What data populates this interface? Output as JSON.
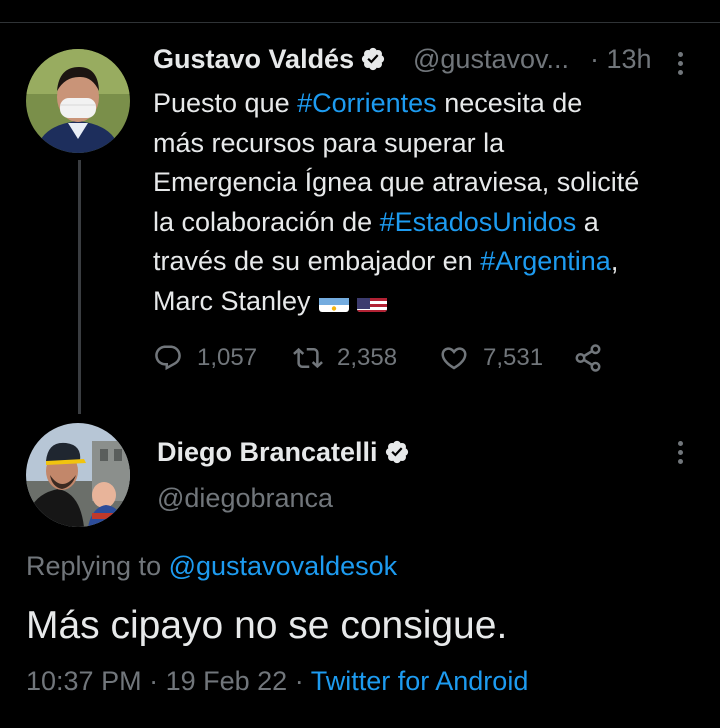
{
  "tweet": {
    "author_name": "Gustavo Valdés",
    "author_handle": "@gustavov...",
    "separator": "·",
    "time": "13h",
    "text_segments": [
      [
        "Puesto que ",
        "#Corrientes",
        " necesita de"
      ],
      [
        "más recursos para superar la"
      ],
      [
        "Emergencia Ígnea que atraviesa, solicité"
      ],
      [
        "la colaboración de ",
        "#EstadosUnidos",
        " a"
      ],
      [
        "través de su embajador en ",
        "#Argentina",
        ","
      ],
      [
        "Marc Stanley"
      ]
    ],
    "flags": [
      "argentina-flag-icon",
      "usa-flag-icon"
    ],
    "stats": {
      "replies": "1,057",
      "retweets": "2,358",
      "likes": "7,531"
    }
  },
  "reply": {
    "author_name": "Diego Brancatelli",
    "author_handle": "@diegobranca",
    "replying_prefix": "Replying to",
    "replying_to": "@gustavovaldesok",
    "text": "Más cipayo no se consigue.",
    "time": "10:37 PM",
    "dot1": "·",
    "date": "19 Feb 22",
    "dot2": "·",
    "source": "Twitter for Android"
  },
  "colors": {
    "background": "#000000",
    "text": "#e7e9ea",
    "muted": "#71767b",
    "link": "#1d9bf0"
  }
}
